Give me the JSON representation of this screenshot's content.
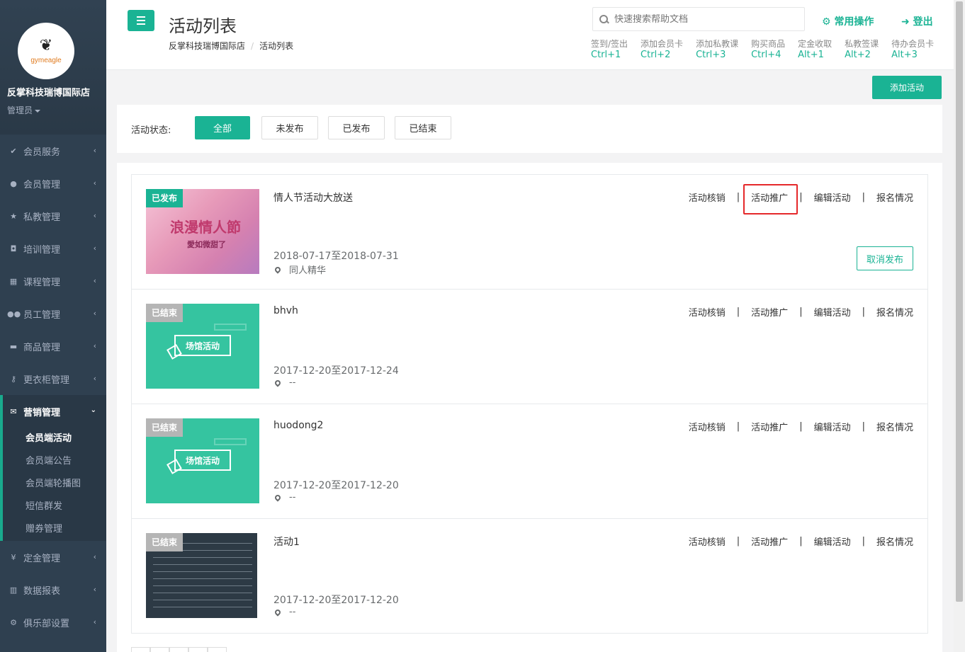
{
  "brand": {
    "logo_text": "gymeagle",
    "shop_name": "反掌科技瑞博国际店",
    "role": "管理员"
  },
  "sidebar": {
    "items_top": [
      {
        "label": "会员服务",
        "icon": "check-icon"
      },
      {
        "label": "会员管理",
        "icon": "user-icon"
      },
      {
        "label": "私教管理",
        "icon": "star-icon"
      },
      {
        "label": "培训管理",
        "icon": "shield-icon"
      },
      {
        "label": "课程管理",
        "icon": "calendar-icon"
      },
      {
        "label": "员工管理",
        "icon": "users-icon"
      },
      {
        "label": "商品管理",
        "icon": "cart-icon"
      },
      {
        "label": "更衣柜管理",
        "icon": "key-icon"
      }
    ],
    "active_group": {
      "label": "营销管理",
      "icon": "envelope-icon",
      "children": [
        "会员端活动",
        "会员端公告",
        "会员端轮播图",
        "短信群发",
        "赠券管理"
      ],
      "active_child": "会员端活动"
    },
    "items_bottom": [
      {
        "label": "定金管理",
        "icon": "yen-icon"
      },
      {
        "label": "数据报表",
        "icon": "bar-chart-icon"
      },
      {
        "label": "俱乐部设置",
        "icon": "gear-icon"
      }
    ]
  },
  "header": {
    "title": "活动列表",
    "breadcrumb": [
      "反掌科技瑞博国际店",
      "活动列表"
    ],
    "breadcrumb_sep": "/",
    "search_placeholder": "快速搜索帮助文档",
    "common_ops": "常用操作",
    "logout": "登出",
    "shortcuts": [
      {
        "label": "签到/签出",
        "key": "Ctrl+1"
      },
      {
        "label": "添加会员卡",
        "key": "Ctrl+2"
      },
      {
        "label": "添加私教课",
        "key": "Ctrl+3"
      },
      {
        "label": "购买商品",
        "key": "Ctrl+4"
      },
      {
        "label": "定金收取",
        "key": "Alt+1"
      },
      {
        "label": "私教签课",
        "key": "Alt+2"
      },
      {
        "label": "待办会员卡",
        "key": "Alt+3"
      }
    ]
  },
  "toolbar": {
    "add_label": "添加活动"
  },
  "filter": {
    "label": "活动状态:",
    "options": [
      "全部",
      "未发布",
      "已发布",
      "已结束"
    ],
    "selected": "全部"
  },
  "actions": {
    "verify": "活动核销",
    "promote": "活动推广",
    "edit": "编辑活动",
    "signup": "报名情况",
    "sep": "|",
    "cancel_publish": "取消发布"
  },
  "activities": [
    {
      "status": "已发布",
      "title": "情人节活动大放送",
      "date": "2018-07-17至2018-07-31",
      "place": "同人精华",
      "image_text": "浪漫情人節",
      "image_sub": "愛如微甜了"
    },
    {
      "status": "已结束",
      "title": "bhvh",
      "date": "2017-12-20至2017-12-24",
      "place": "--",
      "image_text": "场馆活动"
    },
    {
      "status": "已结束",
      "title": "huodong2",
      "date": "2017-12-20至2017-12-20",
      "place": "--",
      "image_text": "场馆活动"
    },
    {
      "status": "已结束",
      "title": "活动1",
      "date": "2017-12-20至2017-12-20",
      "place": "--"
    }
  ],
  "colors": {
    "accent": "#1ab394",
    "sidebar": "#2f4050",
    "highlight": "#e5282a"
  }
}
